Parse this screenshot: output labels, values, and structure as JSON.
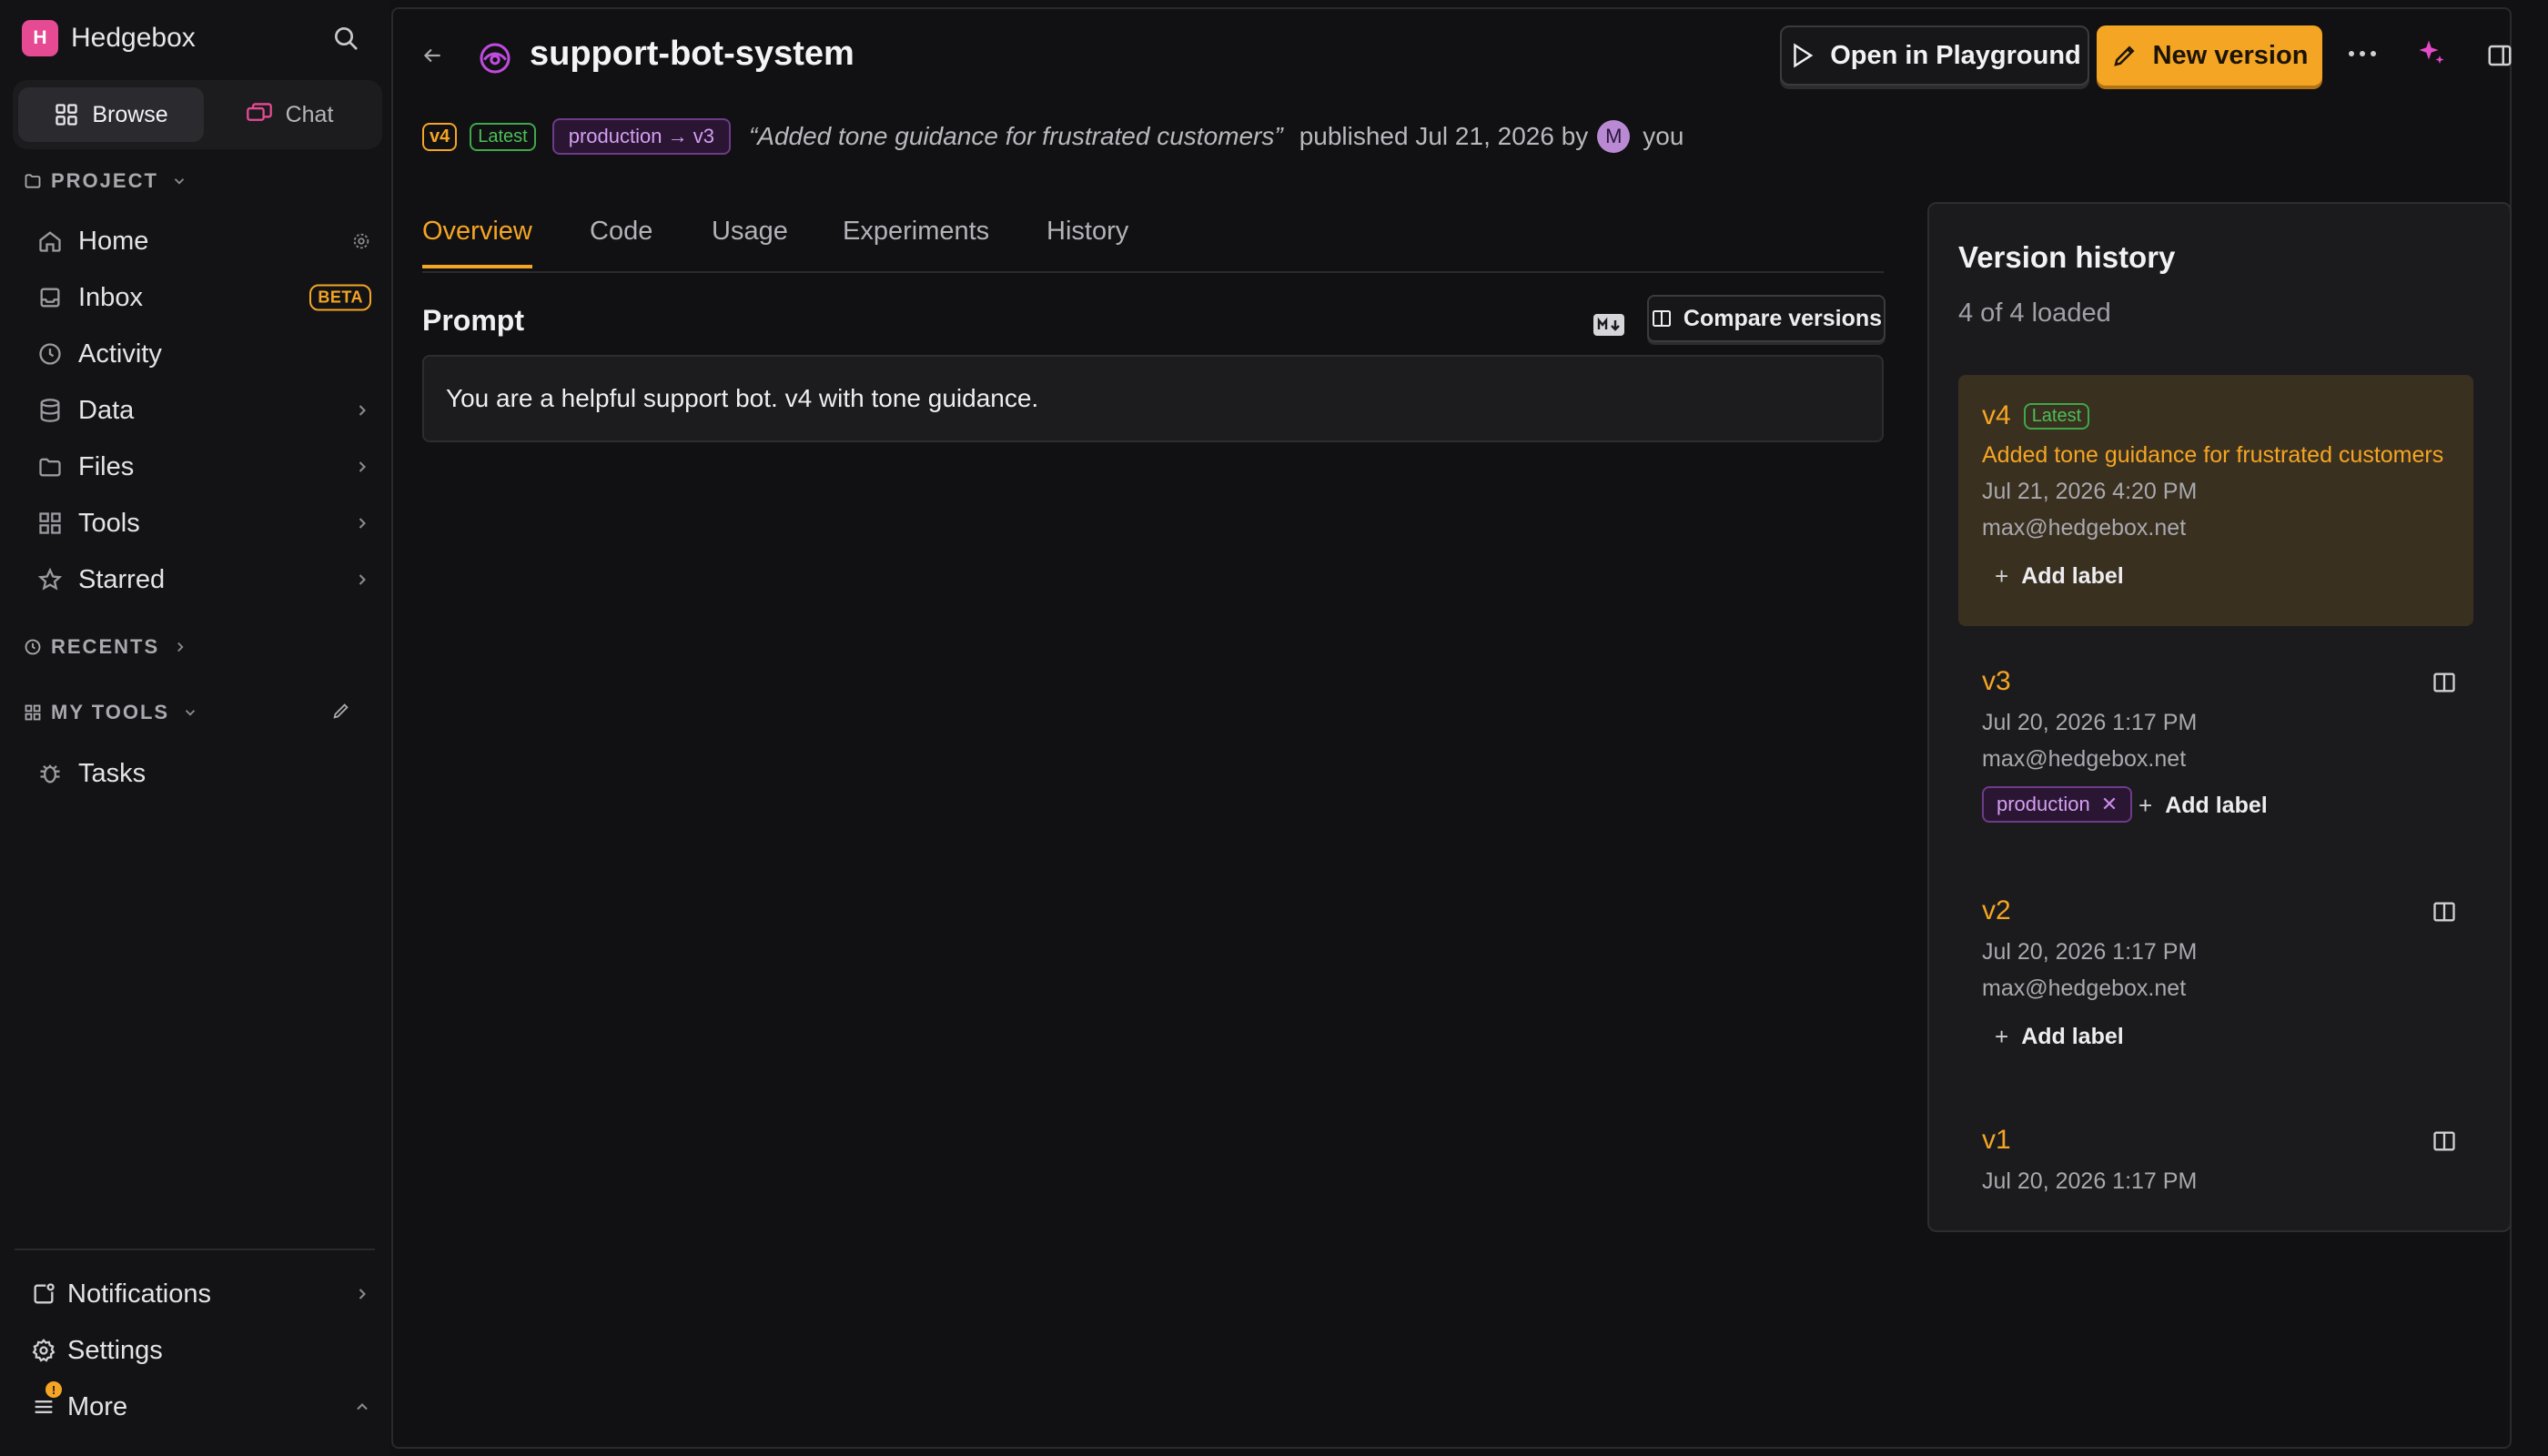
{
  "app": {
    "name": "Hedgebox",
    "logo_letter": "H",
    "brand_color": "#e64a93",
    "accent_color": "#f5a524"
  },
  "sidebar": {
    "modes": [
      {
        "label": "Browse",
        "icon": "grid-icon",
        "active": true
      },
      {
        "label": "Chat",
        "icon": "chat-icon",
        "active": false
      }
    ],
    "project_header": "PROJECT",
    "items": [
      {
        "label": "Home",
        "icon": "home-icon"
      },
      {
        "label": "Inbox",
        "icon": "inbox-icon",
        "badge": "BETA"
      },
      {
        "label": "Activity",
        "icon": "clock-icon"
      },
      {
        "label": "Data",
        "icon": "database-icon"
      },
      {
        "label": "Files",
        "icon": "folder-icon"
      },
      {
        "label": "Tools",
        "icon": "apps-icon"
      },
      {
        "label": "Starred",
        "icon": "star-icon"
      }
    ],
    "recents_header": "RECENTS",
    "my_tools_header": "MY TOOLS",
    "my_tools": [
      {
        "label": "Tasks",
        "icon": "bug-icon"
      }
    ],
    "bottom": [
      {
        "label": "Notifications",
        "icon": "notification-icon"
      },
      {
        "label": "Settings",
        "icon": "gear-icon"
      },
      {
        "label": "More",
        "icon": "menu-icon",
        "dot": "!"
      }
    ]
  },
  "header": {
    "title": "support-bot-system",
    "open_playground": "Open in Playground",
    "new_version": "New version"
  },
  "meta": {
    "version": "v4",
    "latest": "Latest",
    "label": "production → v3",
    "message": "“Added tone guidance for frustrated customers”",
    "published": "published Jul 21, 2026 by",
    "avatar_letter": "M",
    "author": "you"
  },
  "tabs": [
    {
      "label": "Overview",
      "active": true
    },
    {
      "label": "Code",
      "active": false
    },
    {
      "label": "Usage",
      "active": false
    },
    {
      "label": "Experiments",
      "active": false
    },
    {
      "label": "History",
      "active": false
    }
  ],
  "prompt": {
    "heading": "Prompt",
    "compare": "Compare versions",
    "text": "You are a helpful support bot. v4 with tone guidance."
  },
  "version_history": {
    "title": "Version history",
    "count": "4 of 4 loaded",
    "add_label": "Add label",
    "versions": [
      {
        "version": "v4",
        "latest": "Latest",
        "message": "Added tone guidance for frustrated customers",
        "date": "Jul 21, 2026 4:20 PM",
        "author": "max@hedgebox.net",
        "selected": true
      },
      {
        "version": "v3",
        "date": "Jul 20, 2026 1:17 PM",
        "author": "max@hedgebox.net",
        "label": "production"
      },
      {
        "version": "v2",
        "date": "Jul 20, 2026 1:17 PM",
        "author": "max@hedgebox.net"
      },
      {
        "version": "v1",
        "date": "Jul 20, 2026 1:17 PM"
      }
    ]
  }
}
